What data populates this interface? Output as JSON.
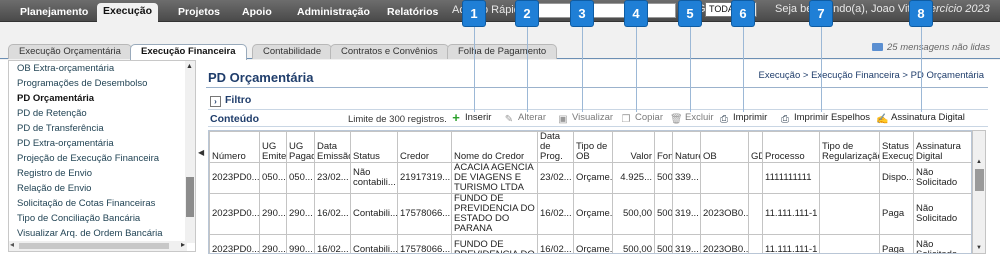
{
  "topbar": {
    "menu": [
      "Planejamento",
      "Execução",
      "Projetos",
      "Apoio",
      "Administração",
      "Relatórios"
    ],
    "acesso_label": "Acesso Rápido",
    "ug_label": "UG",
    "ug_value": "TODAS",
    "welcome": "Seja bem-vindo(a), Joao Vitor",
    "exercicio": "Exercício 2023"
  },
  "tabs": [
    "Execução Orçamentária",
    "Execução Financeira",
    "Contabilidade",
    "Contratos e Convênios",
    "Folha de Pagamento"
  ],
  "messages": "25 mensagens não lidas",
  "sidebar": [
    "OB Extra-orçamentária",
    "Programações de Desembolso",
    "PD Orçamentária",
    "PD de Retenção",
    "PD de Transferência",
    "PD Extra-orçamentária",
    "Projeção de Execução Financeira",
    "Registro de Envio",
    "Relação de Envio",
    "Solicitação de Cotas Financeiras",
    "Tipo de Conciliação Bancária",
    "Visualizar Arq. de Ordem Bancária"
  ],
  "main": {
    "title": "PD Orçamentária",
    "breadcrumb": "Execução > Execução Financeira > PD Orçamentária",
    "filtro": "Filtro",
    "conteudo": "Conteúdo",
    "limite": "Limite de 300 registros.",
    "toolbar": [
      "Inserir",
      "Alterar",
      "Visualizar",
      "Copiar",
      "Excluir",
      "Imprimir",
      "Imprimir Espelhos",
      "Assinatura Digital"
    ]
  },
  "badges": [
    "1",
    "2",
    "3",
    "4",
    "5",
    "6",
    "7",
    "8"
  ],
  "table": {
    "headers": [
      "Número",
      "UG Emitente",
      "UG Pagado",
      "Data Emissão",
      "Status",
      "Credor",
      "Nome do Credor",
      "Data de Prog.",
      "Tipo de OB",
      "Valor",
      "Font",
      "Nature",
      "OB",
      "GD",
      "Processo",
      "Tipo de Regularização",
      "Status Execução",
      "Assinatura Digital"
    ],
    "rows": [
      [
        "2023PD0...",
        "050...",
        "050...",
        "23/02...",
        "Não contabili...",
        "21917319...",
        "ACACIA AGENCIA DE VIAGENS E TURISMO LTDA",
        "23/02...",
        "Orçame...",
        "4.925...",
        "500",
        "339...",
        "",
        "",
        "1111111111",
        "",
        "Dispo...",
        "Não Solicitado"
      ],
      [
        "2023PD0...",
        "290...",
        "290...",
        "16/02...",
        "Contabili...",
        "17578066...",
        "FUNDO DE PREVIDENCIA DO ESTADO DO PARANA",
        "16/02...",
        "Orçame...",
        "500,00",
        "500",
        "319...",
        "2023OB0...",
        "",
        "11.111.111-1",
        "",
        "Paga",
        "Não Solicitado"
      ],
      [
        "2023PD0...",
        "290...",
        "990...",
        "16/02...",
        "Contabili...",
        "17578066...",
        "FUNDO DE PREVIDENCIA DO",
        "16/02...",
        "Orçame...",
        "500,00",
        "500",
        "319...",
        "2023OB0...",
        "",
        "11.111.111-1",
        "",
        "Paga",
        "Não Solicitado"
      ]
    ]
  }
}
